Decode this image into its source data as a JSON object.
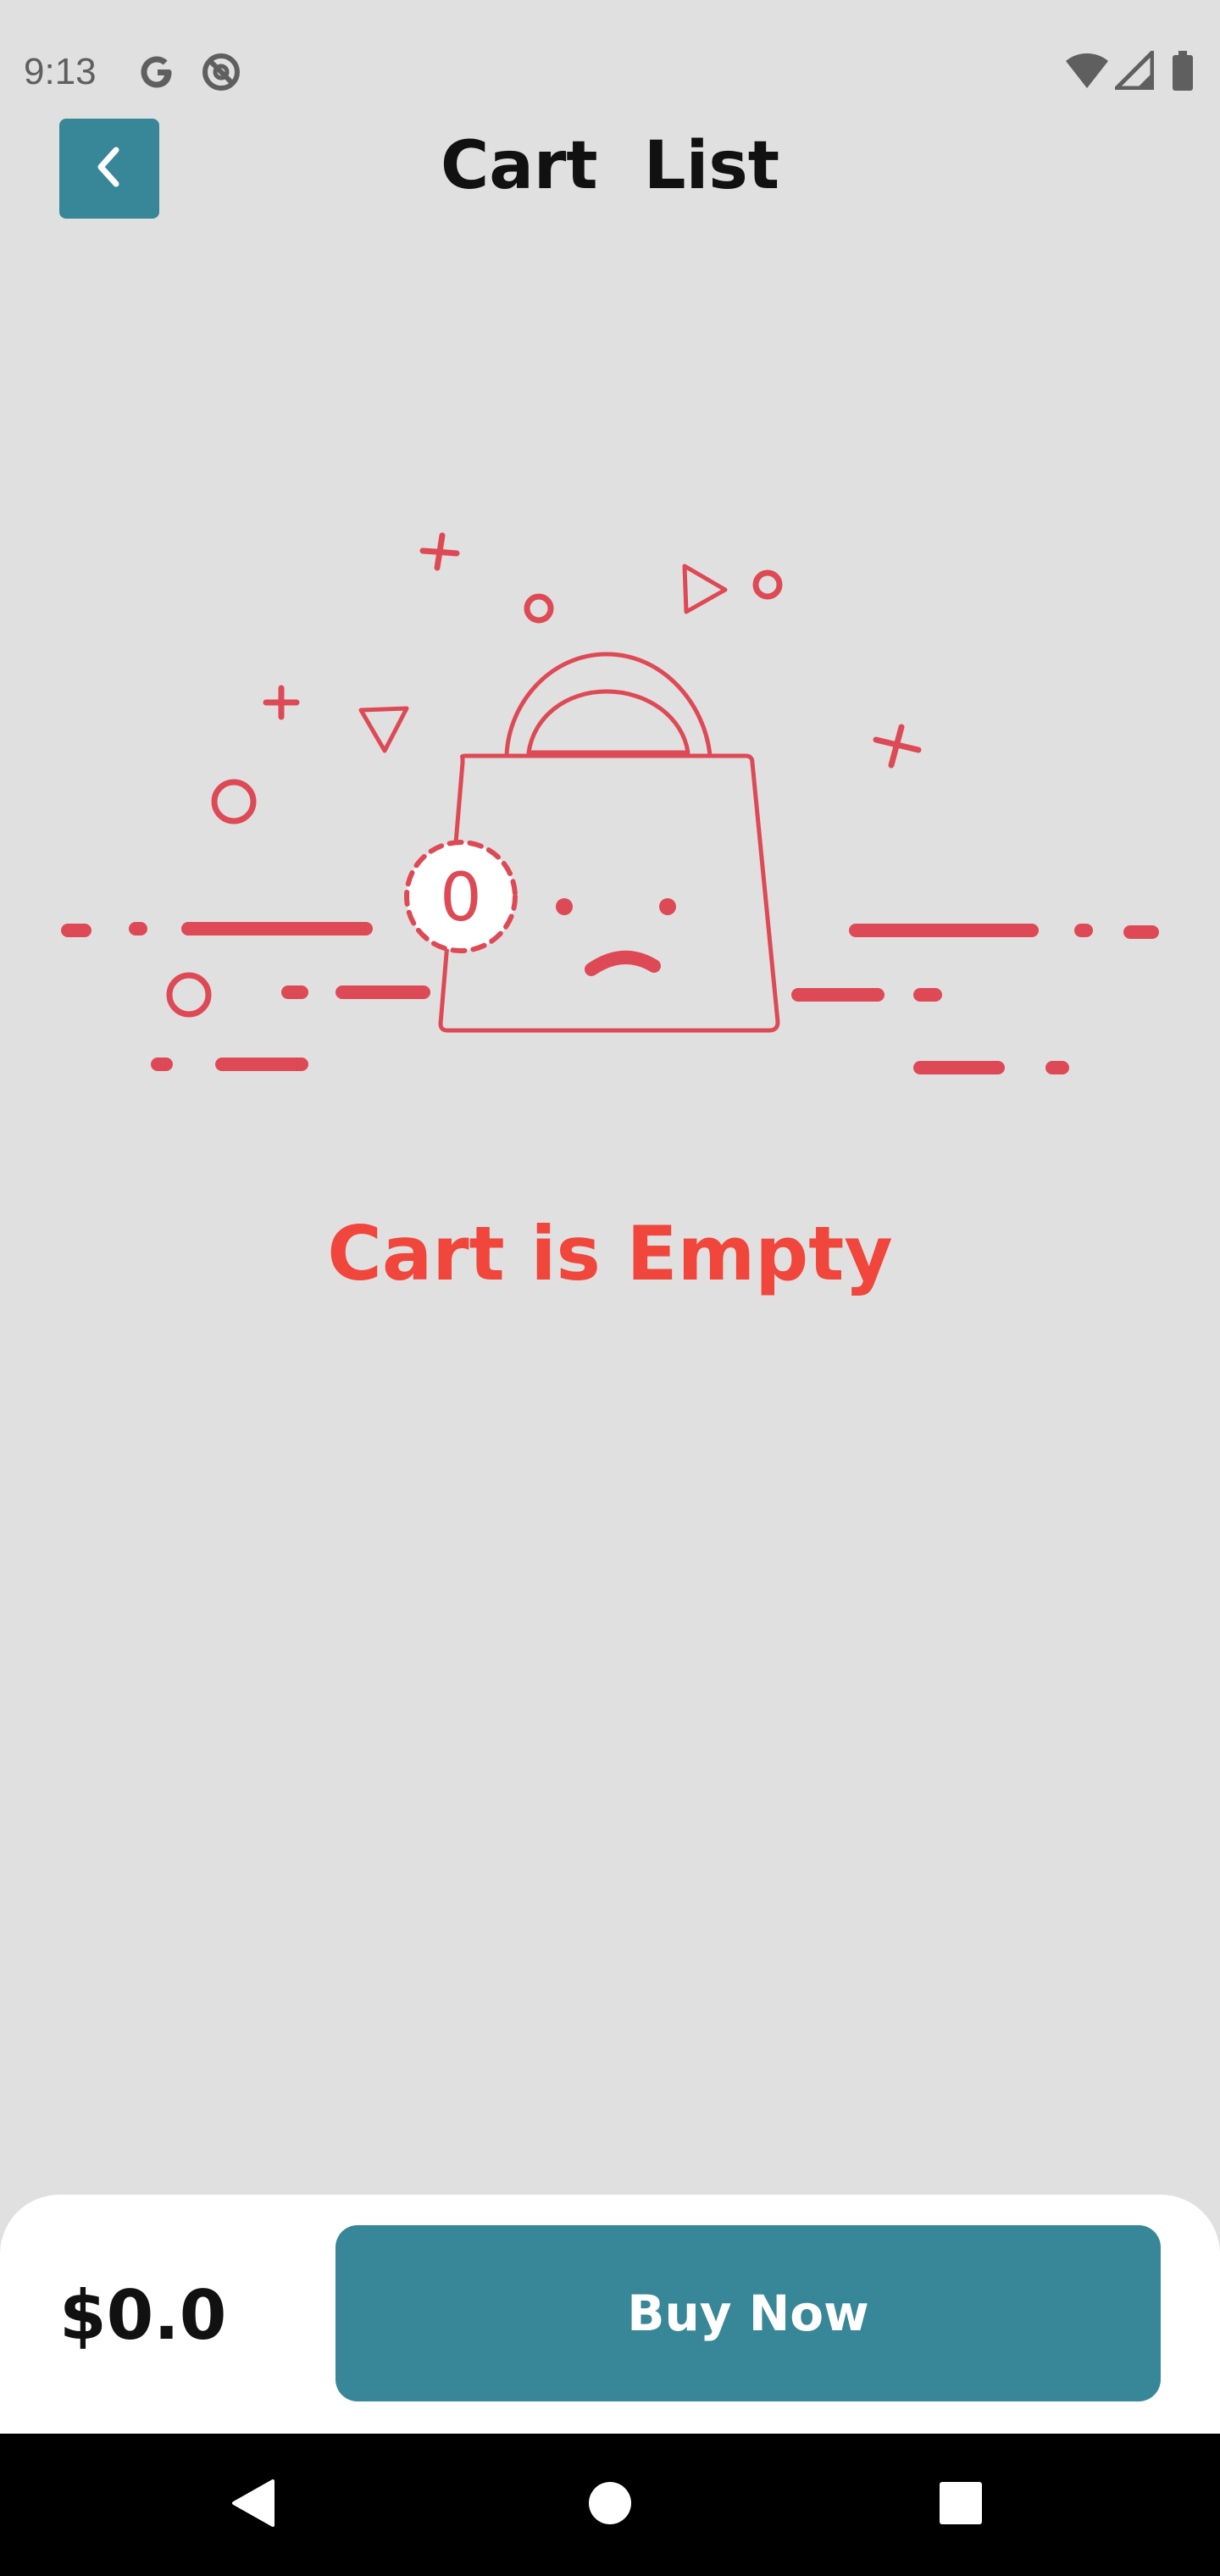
{
  "status_bar": {
    "time": "9:13",
    "icons_left": [
      "google-icon",
      "do-not-disturb-icon"
    ],
    "icons_right": [
      "wifi-icon",
      "cell-signal-icon",
      "battery-icon"
    ]
  },
  "header": {
    "title": "Cart  List",
    "back_icon": "chevron-left-icon"
  },
  "illustration": {
    "badge_count": "0",
    "accent_color": "#dd4a55"
  },
  "empty_state": {
    "message": "Cart is Empty",
    "color": "#f0463b"
  },
  "footer": {
    "total": "$0.0",
    "buy_label": "Buy Now",
    "button_color": "#388798"
  },
  "nav_bar": {
    "buttons": [
      "back-triangle-icon",
      "home-circle-icon",
      "recents-square-icon"
    ]
  }
}
